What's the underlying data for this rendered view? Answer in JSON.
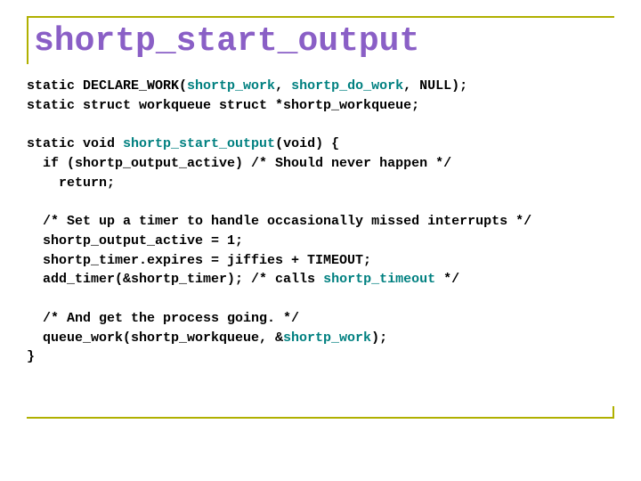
{
  "title": "shortp_start_output",
  "code": {
    "l1a": "static DECLARE_WORK(",
    "l1b": "shortp_work",
    "l1c": ", ",
    "l1d": "shortp_do_work",
    "l1e": ", NULL);",
    "l2": "static struct workqueue struct *shortp_workqueue;",
    "l3": "",
    "l4a": "static void ",
    "l4b": "shortp_start_output",
    "l4c": "(void) {",
    "l5": "  if (shortp_output_active) /* Should never happen */",
    "l6": "    return;",
    "l7": "",
    "l8": "  /* Set up a timer to handle occasionally missed interrupts */",
    "l9": "  shortp_output_active = 1;",
    "l10": "  shortp_timer.expires = jiffies + TIMEOUT;",
    "l11a": "  add_timer(&shortp_timer); /* calls ",
    "l11b": "shortp_timeout",
    "l11c": " */",
    "l12": "",
    "l13": "  /* And get the process going. */",
    "l14a": "  queue_work(shortp_workqueue, &",
    "l14b": "shortp_work",
    "l14c": ");",
    "l15": "}"
  }
}
